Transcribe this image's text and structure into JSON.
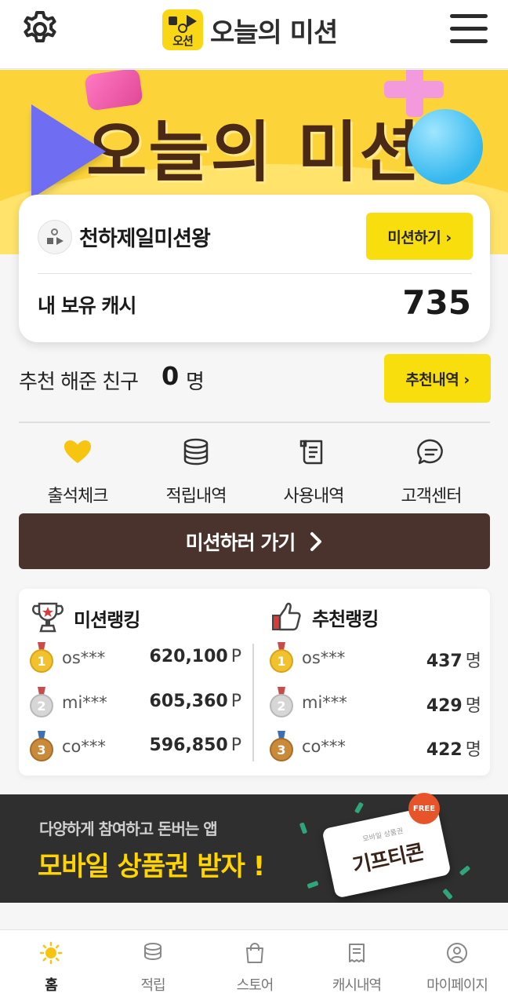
{
  "header": {
    "logo_mark_text": "오션",
    "logo_text": "오늘의 미션"
  },
  "hero": {
    "title": "오늘의 미션"
  },
  "profile": {
    "nickname": "천하제일미션왕",
    "mission_button": "미션하기 ›",
    "cash_label": "내 보유 캐시",
    "cash_value": "735"
  },
  "referral": {
    "label": "추천 해준 친구",
    "count": "0",
    "unit": "명",
    "history_button": "추천내역 ›"
  },
  "quick_menu": [
    {
      "label": "출석체크",
      "icon": "heart-icon"
    },
    {
      "label": "적립내역",
      "icon": "coin-stack-icon"
    },
    {
      "label": "사용내역",
      "icon": "receipt-icon"
    },
    {
      "label": "고객센터",
      "icon": "chat-icon"
    }
  ],
  "go_button": "미션하러 가기",
  "mission_ranking": {
    "title": "미션랭킹",
    "unit": "P",
    "rows": [
      {
        "rank": "1",
        "user": "os***",
        "score": "620,100"
      },
      {
        "rank": "2",
        "user": "mi***",
        "score": "605,360"
      },
      {
        "rank": "3",
        "user": "co***",
        "score": "596,850"
      }
    ]
  },
  "referral_ranking": {
    "title": "추천랭킹",
    "unit": "명",
    "rows": [
      {
        "rank": "1",
        "user": "os***",
        "score": "437"
      },
      {
        "rank": "2",
        "user": "mi***",
        "score": "429"
      },
      {
        "rank": "3",
        "user": "co***",
        "score": "422"
      }
    ]
  },
  "banner": {
    "subtitle": "다양하게 참여하고 돈버는 앱",
    "title": "모바일 상품권 받자 !",
    "ticket_small": "모바일 상품권",
    "ticket_text": "기프티콘",
    "badge": "FREE"
  },
  "bottom_nav": [
    {
      "label": "홈",
      "icon": "sun-icon",
      "active": true
    },
    {
      "label": "적립",
      "icon": "coin-stack-icon",
      "active": false
    },
    {
      "label": "스토어",
      "icon": "shopping-bag-icon",
      "active": false
    },
    {
      "label": "캐시내역",
      "icon": "receipt-icon",
      "active": false
    },
    {
      "label": "마이페이지",
      "icon": "user-circle-icon",
      "active": false
    }
  ],
  "colors": {
    "accent": "#f9de0d",
    "brand_brown": "#4a332c",
    "hero_bg": "#fcd43a",
    "banner_bg": "#2f2f2f",
    "banner_title": "#ffd400"
  }
}
